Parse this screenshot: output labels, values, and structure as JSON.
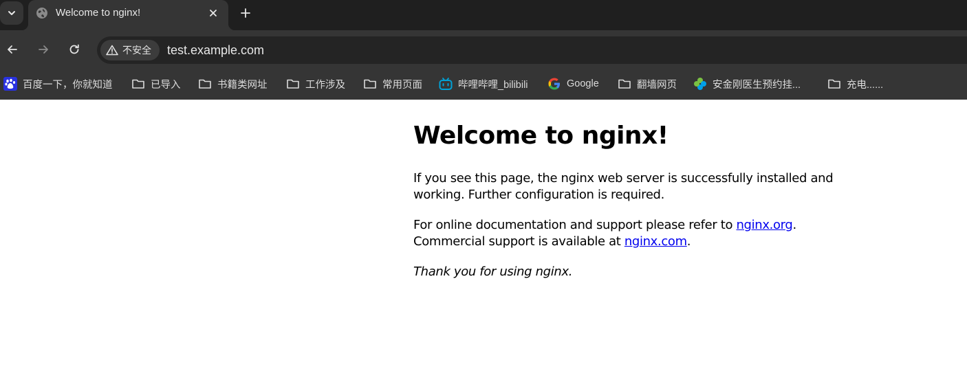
{
  "browser": {
    "tab": {
      "title": "Welcome to nginx!"
    },
    "address_bar": {
      "security_label": "不安全",
      "url": "test.example.com"
    },
    "bookmarks": [
      {
        "label": "百度一下，你就知道",
        "icon": "baidu-icon"
      },
      {
        "label": "已导入",
        "icon": "folder-icon"
      },
      {
        "label": "书籍类网址",
        "icon": "folder-icon"
      },
      {
        "label": "工作涉及",
        "icon": "folder-icon"
      },
      {
        "label": "常用页面",
        "icon": "folder-icon"
      },
      {
        "label": "哔哩哔哩_bilibili",
        "icon": "bilibili-icon"
      },
      {
        "label": "Google",
        "icon": "google-icon"
      },
      {
        "label": "翻墙网页",
        "icon": "folder-icon"
      },
      {
        "label": "安金刚医生预约挂...",
        "icon": "clover-icon"
      },
      {
        "label": "充电......",
        "icon": "folder-icon"
      }
    ],
    "colors": {
      "tabstrip_bg": "#1f1f1f",
      "toolbar_bg": "#353535",
      "omnibox_bg": "#242424"
    }
  },
  "page": {
    "heading": "Welcome to nginx!",
    "para1": "If you see this page, the nginx web server is successfully installed and working. Further configuration is required.",
    "para2_prefix": "For online documentation and support please refer to ",
    "link_org": "nginx.org",
    "para2_mid": ".",
    "para2_prefix2": "Commercial support is available at ",
    "link_com": "nginx.com",
    "para2_suffix": ".",
    "thanks": "Thank you for using nginx.",
    "link_color": "#0000ee"
  }
}
